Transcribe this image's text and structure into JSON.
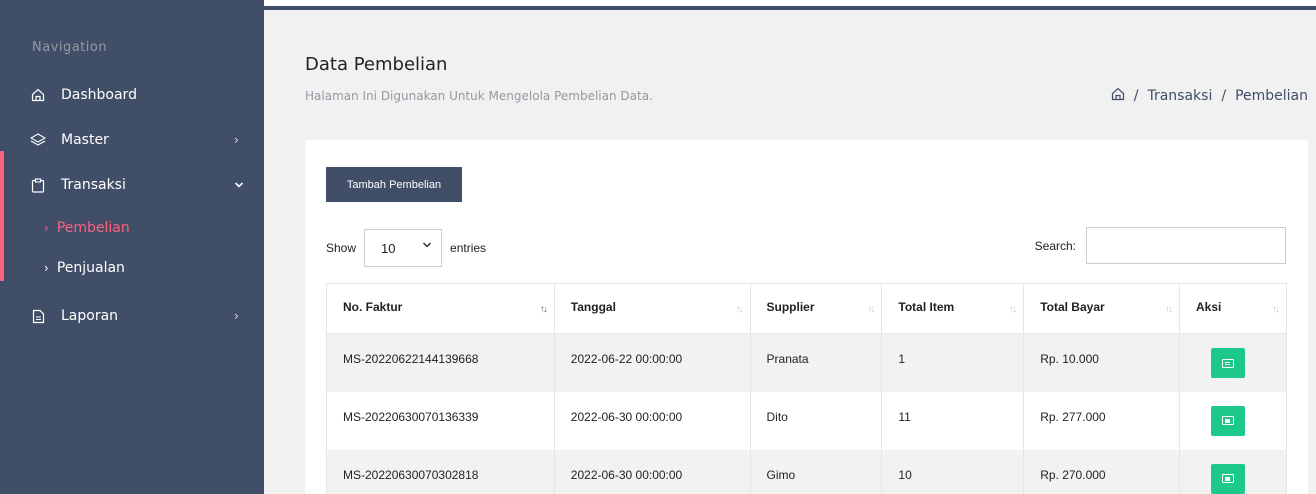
{
  "sidebar": {
    "heading": "Navigation",
    "items": [
      {
        "label": "Dashboard",
        "icon": "home-icon"
      },
      {
        "label": "Master",
        "icon": "layers-icon",
        "chevron": "›"
      },
      {
        "label": "Transaksi",
        "icon": "clipboard-icon",
        "chevron": "⌄"
      },
      {
        "label": "Laporan",
        "icon": "file-icon",
        "chevron": "›"
      }
    ],
    "sub_items": [
      {
        "label": "Pembelian",
        "active": true
      },
      {
        "label": "Penjualan",
        "active": false
      }
    ],
    "active_color": "#fc6180"
  },
  "header": {
    "title": "Data Pembelian",
    "subtitle": "Halaman Ini Digunakan Untuk Mengelola Pembelian Data.",
    "breadcrumb": [
      "Transaksi",
      "Pembelian"
    ]
  },
  "toolbar": {
    "add_label": "Tambah Pembelian"
  },
  "length": {
    "show_label": "Show",
    "value": "10",
    "entries_label": "entries"
  },
  "search": {
    "label": "Search:",
    "value": ""
  },
  "table": {
    "columns": [
      "No. Faktur",
      "Tanggal",
      "Supplier",
      "Total Item",
      "Total Bayar",
      "Aksi"
    ],
    "rows": [
      [
        "MS-20220622144139668",
        "2022-06-22 00:00:00",
        "Pranata",
        "1",
        "Rp. 10.000"
      ],
      [
        "MS-20220630070136339",
        "2022-06-30 00:00:00",
        "Dito",
        "11",
        "Rp. 277.000"
      ],
      [
        "MS-20220630070302818",
        "2022-06-30 00:00:00",
        "Gimo",
        "10",
        "Rp. 270.000"
      ]
    ],
    "action_icon": "detail-icon",
    "action_color": "#1cc88a"
  },
  "colors": {
    "sidebar_bg": "#404e67",
    "button_bg": "#404e67"
  }
}
